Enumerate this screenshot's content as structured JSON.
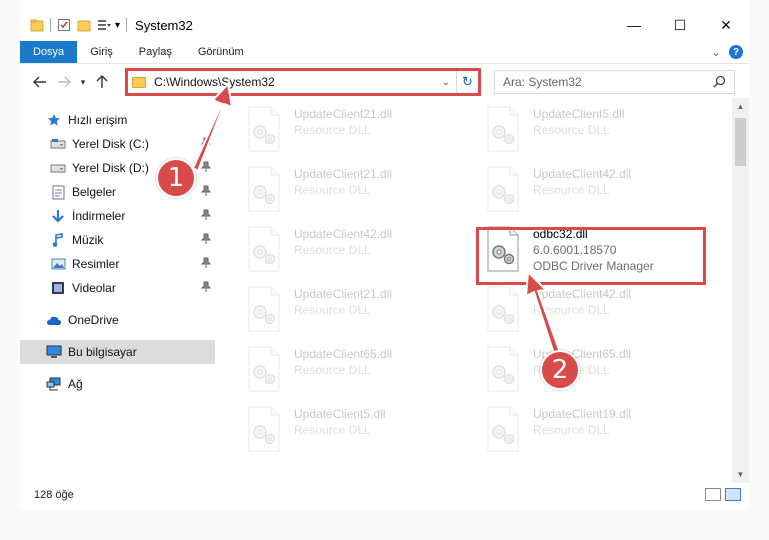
{
  "window": {
    "title": "System32",
    "minimize_glyph": "—",
    "maximize_glyph": "☐",
    "close_glyph": "✕"
  },
  "ribbon": {
    "tabs": [
      {
        "label": "Dosya",
        "active": true
      },
      {
        "label": "Giriş",
        "active": false
      },
      {
        "label": "Paylaş",
        "active": false
      },
      {
        "label": "Görünüm",
        "active": false
      }
    ],
    "expand_glyph": "⌄",
    "help_glyph": "?"
  },
  "navbar": {
    "address": "C:\\Windows\\System32",
    "search_placeholder": "Ara: System32"
  },
  "sidebar": {
    "items": [
      {
        "label": "Hızlı erişim",
        "icon": "star-icon",
        "pinned": false
      },
      {
        "label": "Yerel Disk (C:)",
        "icon": "drive-icon",
        "pinned": true
      },
      {
        "label": "Yerel Disk (D:)",
        "icon": "drive-icon",
        "pinned": true
      },
      {
        "label": "Belgeler",
        "icon": "documents-icon",
        "pinned": true
      },
      {
        "label": "İndirmeler",
        "icon": "download-icon",
        "pinned": true
      },
      {
        "label": "Müzik",
        "icon": "music-icon",
        "pinned": true
      },
      {
        "label": "Resimler",
        "icon": "pictures-icon",
        "pinned": true
      },
      {
        "label": "Videolar",
        "icon": "video-icon",
        "pinned": true
      },
      {
        "label": "OneDrive",
        "icon": "cloud-icon",
        "pinned": false
      },
      {
        "label": "Bu bilgisayar",
        "icon": "computer-icon",
        "pinned": false
      },
      {
        "label": "Ağ",
        "icon": "network-icon",
        "pinned": false
      }
    ]
  },
  "files": [
    {
      "name": "UpdateClient21.dll",
      "line2": "Resource DLL",
      "line3": "",
      "faded": true
    },
    {
      "name": "UpdateClient5.dll",
      "line2": "Resource DLL",
      "line3": "",
      "faded": true
    },
    {
      "name": "UpdateClient21.dll",
      "line2": "Resource DLL",
      "line3": "",
      "faded": true
    },
    {
      "name": "UpdateClient42.dll",
      "line2": "Resource DLL",
      "line3": "",
      "faded": true
    },
    {
      "name": "UpdateClient42.dll",
      "line2": "Resource DLL",
      "line3": "",
      "faded": true
    },
    {
      "name": "odbc32.dll",
      "line2": "6.0.6001.18570",
      "line3": "ODBC Driver Manager",
      "faded": false
    },
    {
      "name": "UpdateClient21.dll",
      "line2": "Resource DLL",
      "line3": "",
      "faded": true
    },
    {
      "name": "UpdateClient42.dll",
      "line2": "Resource DLL",
      "line3": "",
      "faded": true
    },
    {
      "name": "UpdateClient65.dll",
      "line2": "Resource DLL",
      "line3": "",
      "faded": true
    },
    {
      "name": "UpdateClient65.dll",
      "line2": "Resource DLL",
      "line3": "",
      "faded": true
    },
    {
      "name": "UpdateClient5.dll",
      "line2": "Resource DLL",
      "line3": "",
      "faded": true
    },
    {
      "name": "UpdateClient19.dll",
      "line2": "Resource DLL",
      "line3": "",
      "faded": true
    }
  ],
  "status": {
    "item_count": "128 öğe"
  },
  "annotations": {
    "step1": "1",
    "step2": "2",
    "color": "#d94a4a"
  },
  "colors": {
    "accent": "#1979ca",
    "folder": "#f8cc55",
    "highlight": "#d94a4a"
  }
}
